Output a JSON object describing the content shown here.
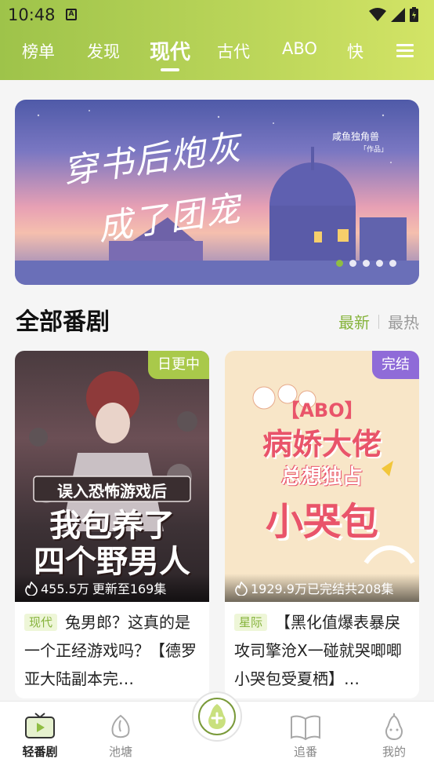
{
  "status_bar": {
    "time": "10:48",
    "notif_glyph": "A"
  },
  "top_tabs": [
    {
      "label": "榜单"
    },
    {
      "label": "发现"
    },
    {
      "label": "现代"
    },
    {
      "label": "古代"
    },
    {
      "label": "ABO"
    },
    {
      "label": "快"
    }
  ],
  "banner": {
    "title_line1": "穿书后炮灰",
    "title_line2": "成了团宠",
    "author": "咸鱼独角兽",
    "author_sub": "「作品」",
    "active_index": 0,
    "count": 5
  },
  "section": {
    "title": "全部番剧",
    "sort_new": "最新",
    "sort_hot": "最热"
  },
  "cards": [
    {
      "badge": "日更中",
      "badge_color": "#a9c94a",
      "cover_line1": "误入恐怖游戏后",
      "cover_line2": "我包养了",
      "cover_line3": "四个野男人",
      "plays": "455.5万",
      "episodes": "更新至169集",
      "tag": "现代",
      "desc": "兔男郎？这真的是一个正经游戏吗？【德罗亚大陆副本完…"
    },
    {
      "badge": "完结",
      "badge_color": "#8f6bd8",
      "cover_line1": "【ABO】",
      "cover_line2": "病娇大佬",
      "cover_line3": "总想独占",
      "cover_line4": "小哭包",
      "plays": "1929.9万",
      "episodes": "已完结共208集",
      "tag": "星际",
      "desc": "【黑化值爆表暴戾攻司擎沧X一碰就哭唧唧小哭包受夏栖】…"
    }
  ],
  "bottom_nav": [
    {
      "label": "轻番剧",
      "icon": "tv-icon"
    },
    {
      "label": "池塘",
      "icon": "pond-icon"
    },
    {
      "label": "追番",
      "icon": "book-icon"
    },
    {
      "label": "我的",
      "icon": "pear-face-icon"
    }
  ],
  "colors": {
    "accent": "#86b33c",
    "header_start": "#9ec34a",
    "header_end": "#d3e466"
  }
}
